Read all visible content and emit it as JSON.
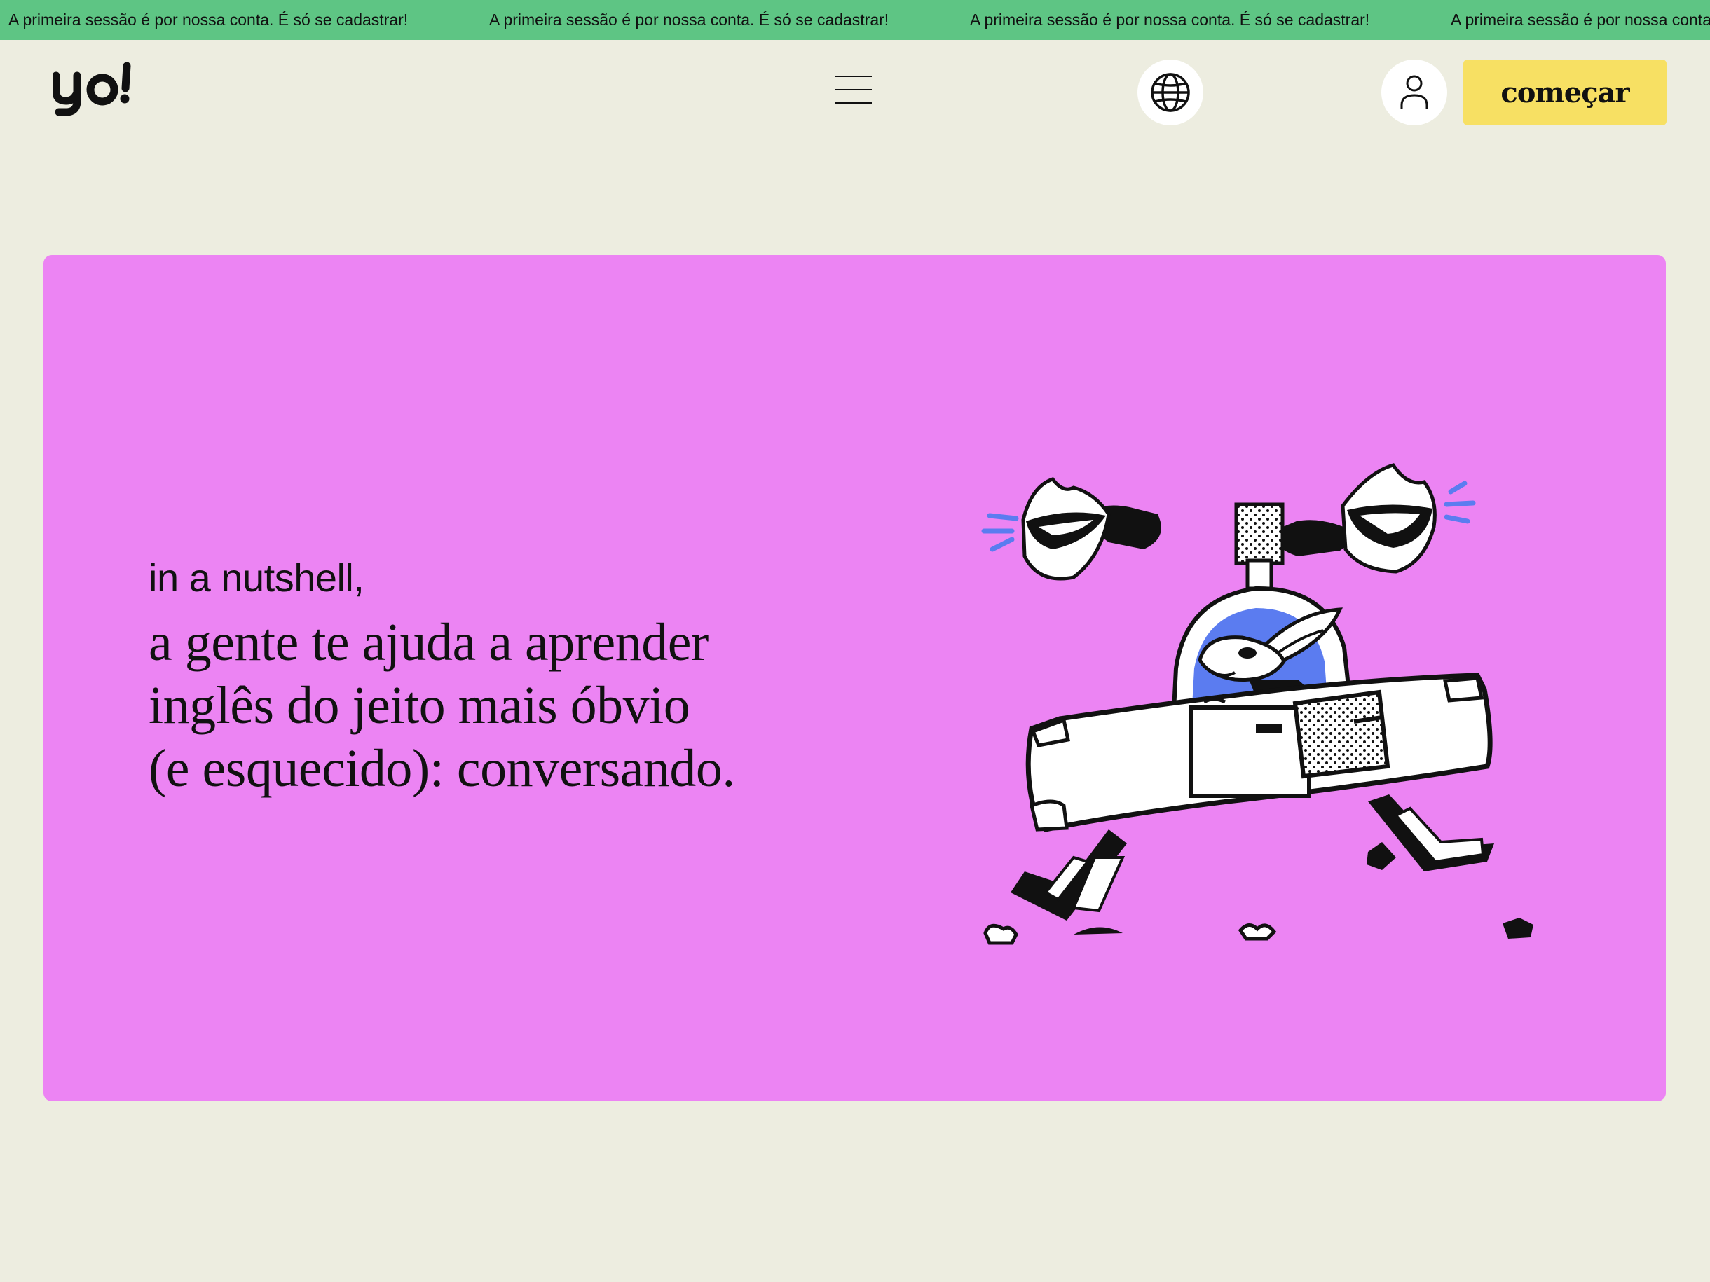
{
  "ticker": {
    "message": "A primeira sessão é por nossa conta. É só se cadastrar!",
    "background_color": "#5ec584"
  },
  "header": {
    "logo_text": "yo!",
    "menu_icon": "hamburger-menu-icon",
    "language_icon": "globe-icon",
    "account_icon": "user-icon",
    "cta_label": "começar",
    "cta_color": "#f7e063"
  },
  "hero": {
    "kicker": "in a nutshell,",
    "headline_lines": [
      "a gente te ajuda a aprender",
      "inglês do jeito mais óbvio",
      "(e esquecido): conversando."
    ],
    "illustration": "rabbit-driving-car-with-lips-illustration",
    "background_color": "#ec84f3"
  },
  "colors": {
    "page_background": "#edede0",
    "accent_blue": "#5b7cf0"
  }
}
